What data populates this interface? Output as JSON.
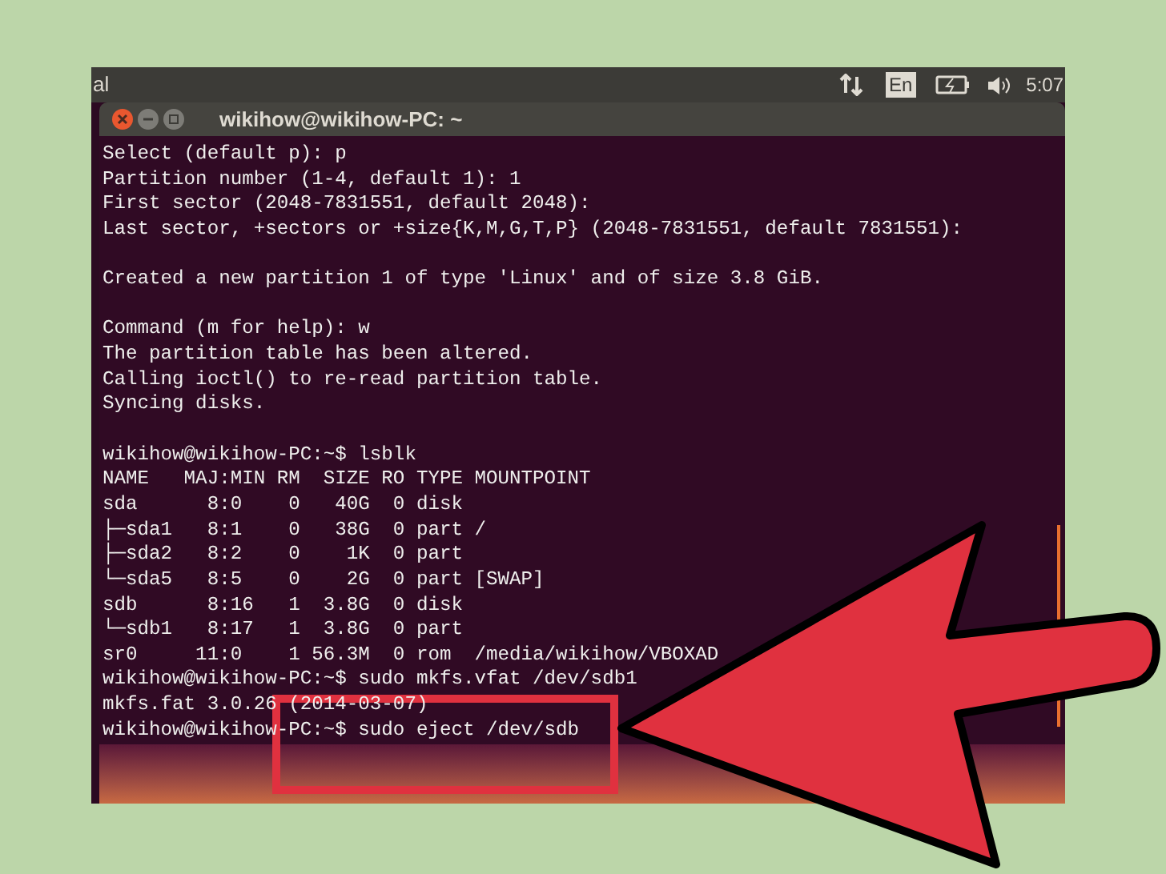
{
  "top_panel": {
    "app_name": "al",
    "keyboard_layout": "En",
    "clock": "5:07"
  },
  "window": {
    "title": "wikihow@wikihow-PC: ~"
  },
  "terminal": {
    "blocks": [
      [
        "Select (default p): p",
        "Partition number (1-4, default 1): 1",
        "First sector (2048-7831551, default 2048):",
        "Last sector, +sectors or +size{K,M,G,T,P} (2048-7831551, default 7831551):"
      ],
      [
        "Created a new partition 1 of type 'Linux' and of size 3.8 GiB."
      ],
      [
        "Command (m for help): w",
        "The partition table has been altered.",
        "Calling ioctl() to re-read partition table.",
        "Syncing disks."
      ],
      [
        "wikihow@wikihow-PC:~$ lsblk",
        "NAME   MAJ:MIN RM  SIZE RO TYPE MOUNTPOINT",
        "sda      8:0    0   40G  0 disk",
        "├─sda1   8:1    0   38G  0 part /",
        "├─sda2   8:2    0    1K  0 part",
        "└─sda5   8:5    0    2G  0 part [SWAP]",
        "sdb      8:16   1  3.8G  0 disk",
        "└─sdb1   8:17   1  3.8G  0 part",
        "sr0     11:0    1 56.3M  0 rom  /media/wikihow/VBOXAD",
        "wikihow@wikihow-PC:~$ sudo mkfs.vfat /dev/sdb1",
        "mkfs.fat 3.0.26 (2014-03-07)",
        "wikihow@wikihow-PC:~$ sudo eject /dev/sdb"
      ]
    ]
  }
}
